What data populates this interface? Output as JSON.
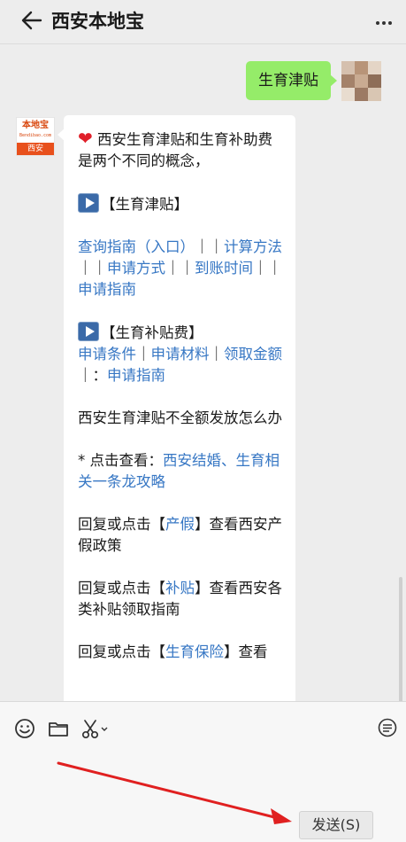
{
  "header": {
    "title": "西安本地宝"
  },
  "me": {
    "message": "生育津贴"
  },
  "bot": {
    "avatar": {
      "logo_text": "本地宝",
      "logo_sub": "Bendibao.com",
      "city": "西安"
    },
    "intro_icon": "heart-icon",
    "intro": "西安生育津贴和生育补助费是两个不同的概念，",
    "section1_title": "【生育津贴】",
    "section1_links": {
      "l1": "查询指南（入口）",
      "s1": "｜｜",
      "l2": "计算方法",
      "s2": "｜｜",
      "l3": "申请方式",
      "s3": "｜｜",
      "l4": "到账时间",
      "s4": "｜｜",
      "l5": "申请指南"
    },
    "section2_title": "【生育补贴费】",
    "section2_links": {
      "l1": "申请条件",
      "s1": "｜",
      "l2": "申请材料",
      "s2": "｜",
      "l3": "领取金额",
      "s3": "｜：",
      "l4": "申请指南"
    },
    "q_text": "西安生育津贴不全额发放怎么办",
    "click_prefix": "* 点击查看：",
    "click_link": "西安结婚、生育相关一条龙攻略",
    "reply1": {
      "pre": "回复或点击【",
      "kw": "产假",
      "post": "】查看西安产假政策"
    },
    "reply2": {
      "pre": "回复或点击【",
      "kw": "补贴",
      "post": "】查看西安各类补贴领取指南"
    },
    "reply3": {
      "pre": "回复或点击【",
      "kw": "生育保险",
      "post": "】查看"
    }
  },
  "input": {
    "send_label": "发送(S)"
  },
  "colors": {
    "accent_green": "#95ec69",
    "link": "#3777c4",
    "arrow": "#e02020"
  }
}
